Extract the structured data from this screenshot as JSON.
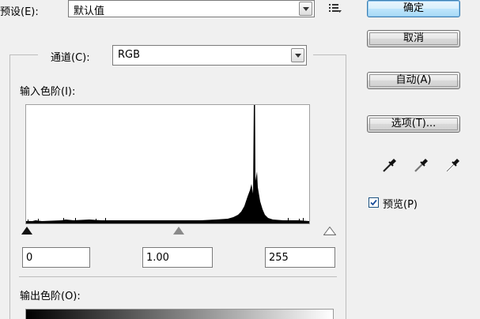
{
  "preset": {
    "label": "预设(E):",
    "value": "默认值"
  },
  "channel": {
    "label": "通道(C):",
    "value": "RGB"
  },
  "input_levels": {
    "label": "输入色阶(I):",
    "black": "0",
    "gamma": "1.00",
    "white": "255"
  },
  "output_levels": {
    "label": "输出色阶(O):"
  },
  "buttons": {
    "ok": "确定",
    "cancel": "取消",
    "auto": "自动(A)",
    "options": "选项(T)..."
  },
  "preview": {
    "label": "预览(P)",
    "checked": true
  },
  "icons": {
    "preset_menu": "list-menu-icon",
    "eyedroppers": [
      "black-eyedropper-icon",
      "gray-eyedropper-icon",
      "white-eyedropper-icon"
    ]
  },
  "colors": {
    "histogram": "#000000",
    "default_button_border": "#3c7fb1",
    "checkbox_check": "#1a4e9a"
  }
}
